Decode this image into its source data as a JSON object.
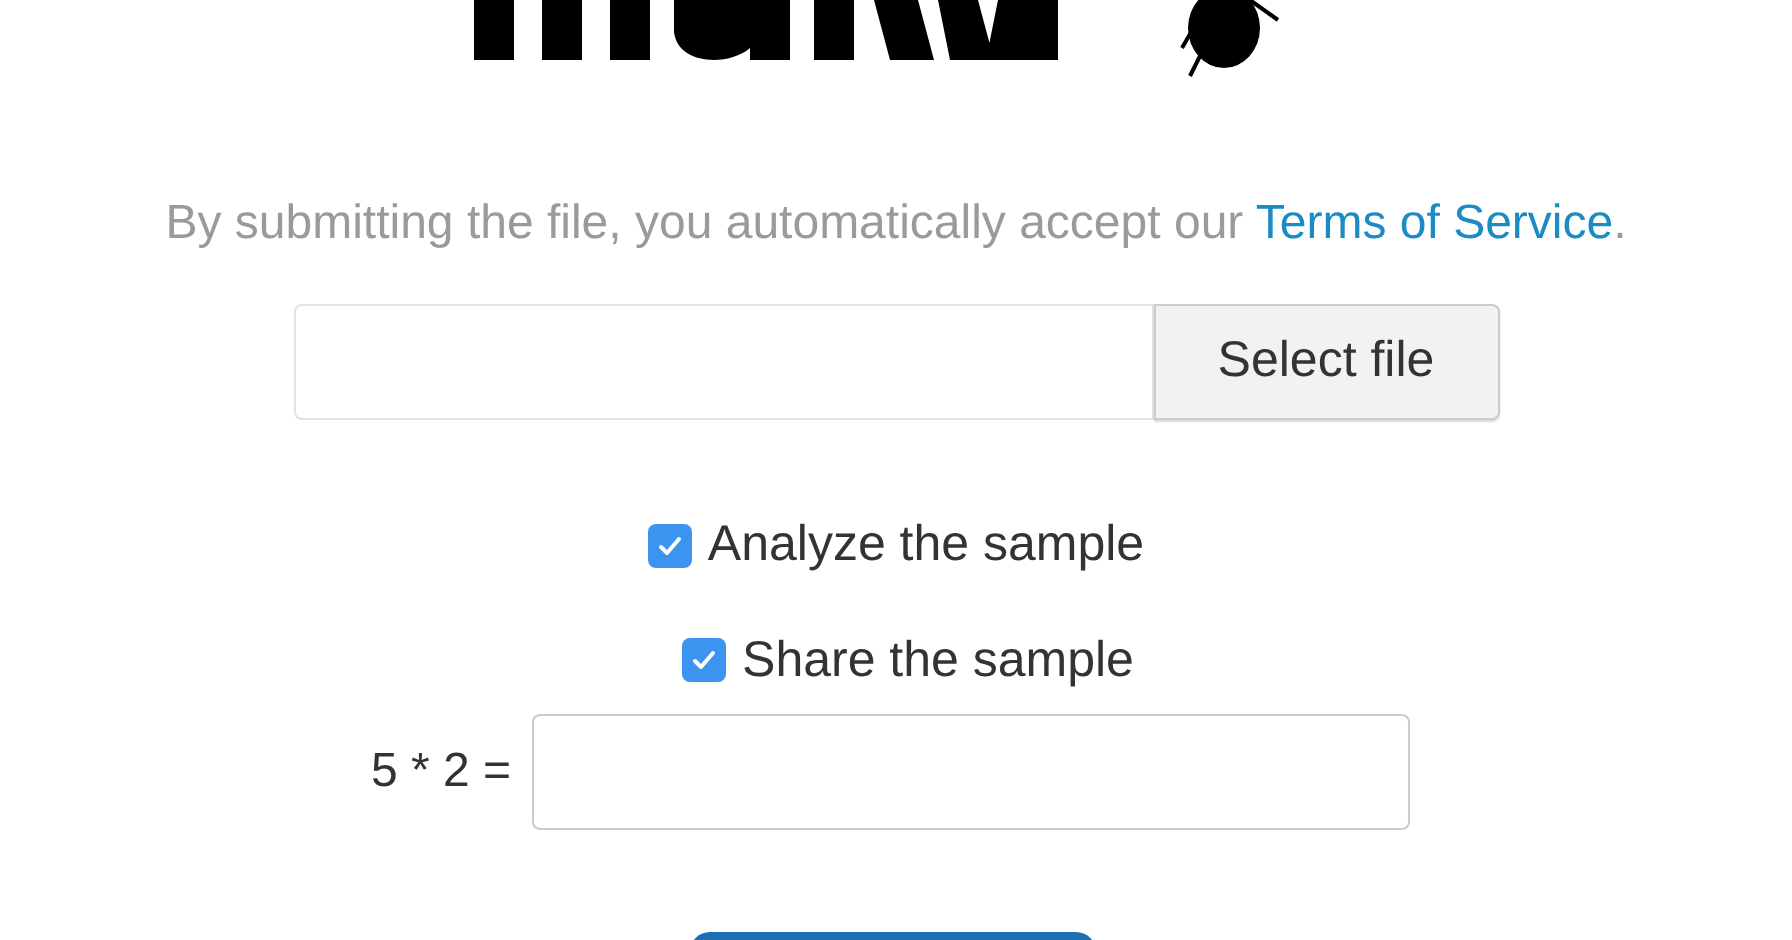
{
  "notice": {
    "text": "By submitting the file, you automatically accept our ",
    "link": "Terms of Service",
    "end": "."
  },
  "file_picker": {
    "button": "Select file"
  },
  "options": [
    {
      "label": "Analyze the sample",
      "checked": true
    },
    {
      "label": "Share the sample",
      "checked": true
    }
  ],
  "captcha": {
    "question": "5 * 2 ="
  }
}
